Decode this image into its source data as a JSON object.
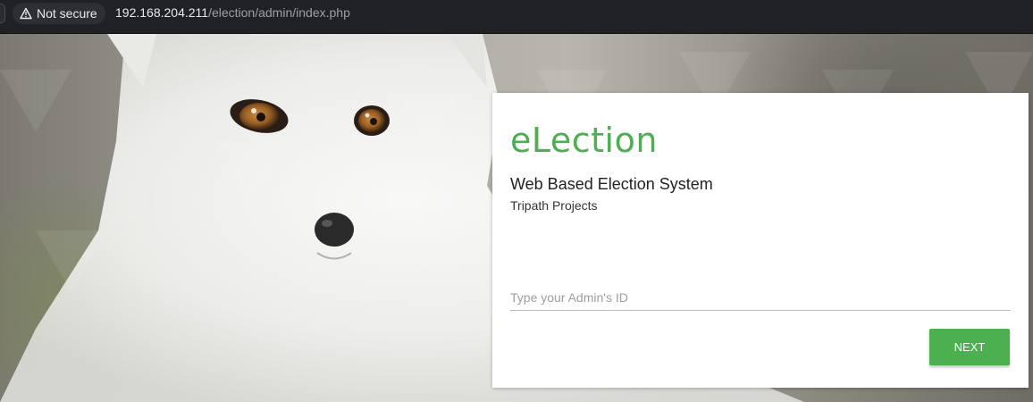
{
  "browser": {
    "security_label": "Not secure",
    "url_host": "192.168.204.211",
    "url_path": "/election/admin/index.php"
  },
  "login": {
    "brand": "eLection",
    "subtitle": "Web Based Election System",
    "organization": "Tripath Projects",
    "admin_id_placeholder": "Type your Admin's ID",
    "admin_id_value": "",
    "next_label": "NEXT"
  },
  "colors": {
    "brand_green": "#4caf50",
    "browser_bar": "#202124"
  },
  "icons": {
    "security": "warning-triangle-icon"
  }
}
